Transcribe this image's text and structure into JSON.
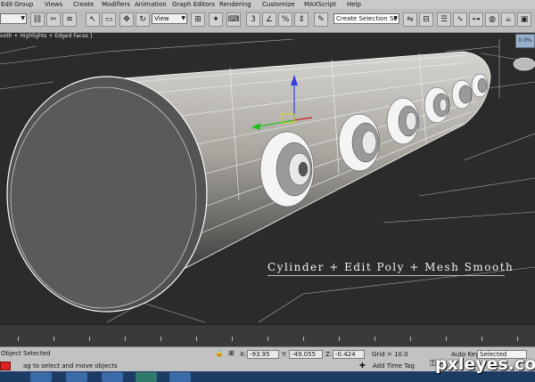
{
  "menu": {
    "items": [
      "Edit",
      "Group",
      "Views",
      "Create",
      "Modifiers",
      "Animation",
      "Graph Editors",
      "Rendering",
      "Customize",
      "MAXScript",
      "Help"
    ]
  },
  "toolbar": {
    "view_dropdown": "View",
    "selection_set_dropdown": "Create Selection Se",
    "snap_label": "3",
    "angle_snap_label": "%"
  },
  "viewport": {
    "label": "ooth + Highlights + Edged Faces ]",
    "caption": "Cylinder + Edit Poly + Mesh Smooth",
    "percent_label": "0.0%"
  },
  "status": {
    "selection_text": "Object Selected",
    "prompt_text": "ag to select and move objects",
    "x_label": "X:",
    "x_value": "-93.95",
    "y_label": "Y:",
    "y_value": "-49.055",
    "z_label": "Z:",
    "z_value": "-0.424",
    "grid_text": "Grid = 10.0",
    "add_time_tag": "Add Time Tag",
    "auto_key": "Auto Key",
    "key_mode": "Selected"
  },
  "watermark": "pxleyes.com",
  "colors": {
    "viewport_bg": "#2b2b2b",
    "ui_gray": "#c2c2c2",
    "taskbar": "#1c3c66",
    "axis_z": "#2f3fe0",
    "axis_x": "#d02020",
    "axis_y": "#20c020"
  }
}
